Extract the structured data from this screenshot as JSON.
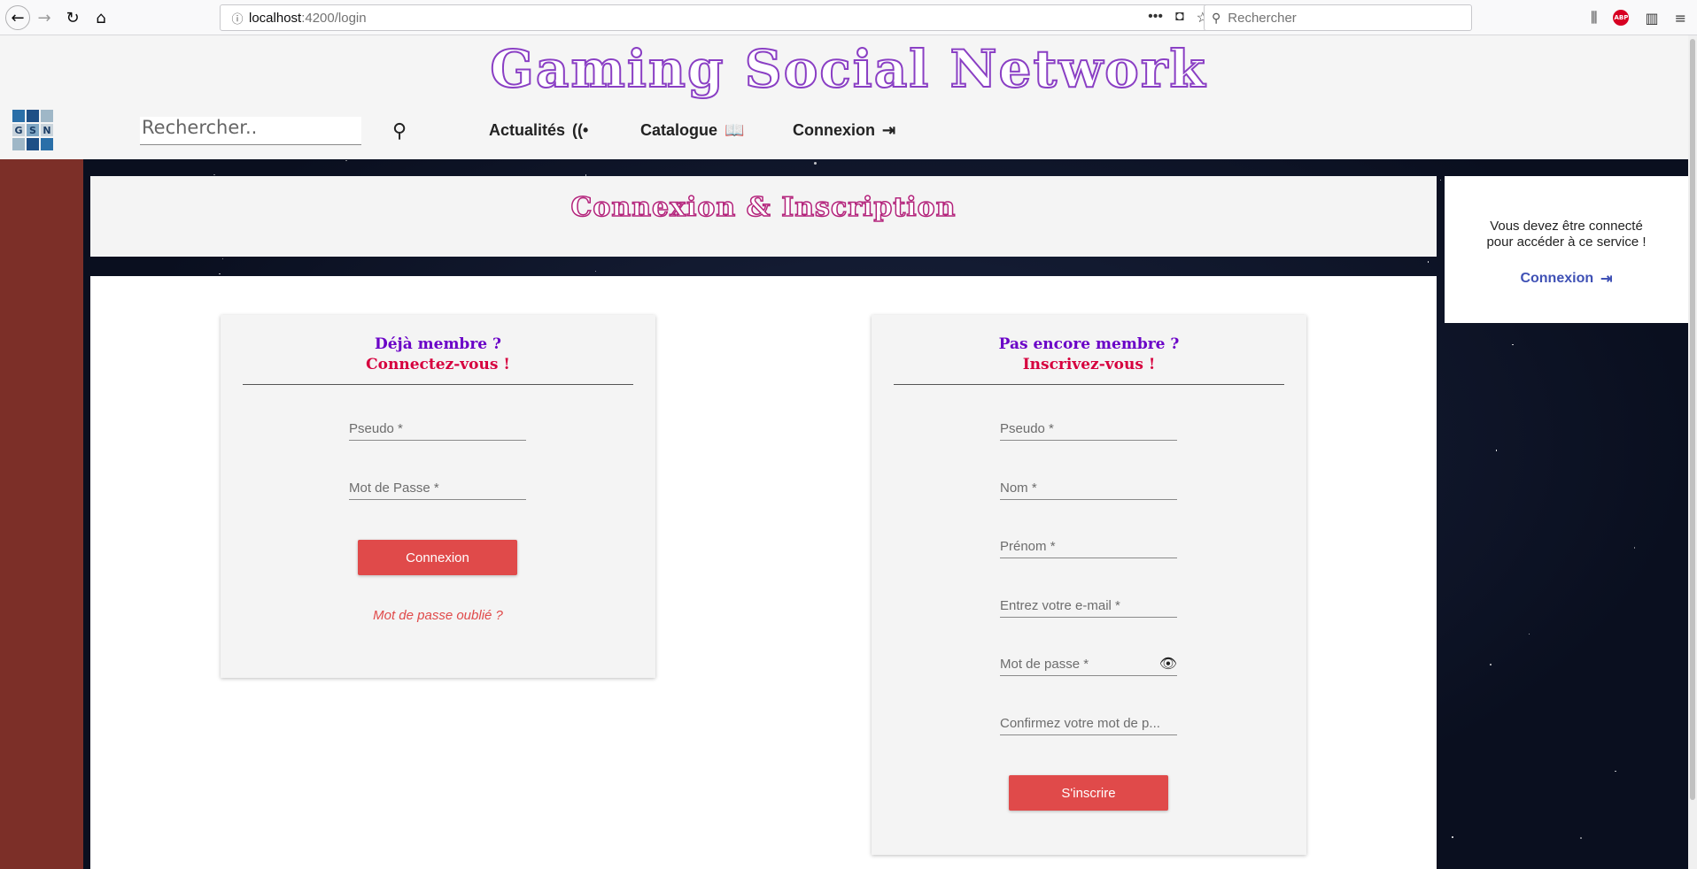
{
  "browser": {
    "url_host": "localhost",
    "url_path": ":4200/login",
    "search_placeholder": "Rechercher"
  },
  "header": {
    "site_title": "Gaming Social Network",
    "logo_letters": [
      "G",
      "S",
      "N"
    ],
    "search_placeholder": "Rechercher..",
    "nav": [
      {
        "label": "Actualités",
        "icon": "rss-icon"
      },
      {
        "label": "Catalogue",
        "icon": "book-reader-icon"
      },
      {
        "label": "Connexion",
        "icon": "sign-in-icon"
      }
    ]
  },
  "page": {
    "title": "Connexion & Inscription"
  },
  "sidebar": {
    "message": "Vous devez être connecté\npour accéder à ce service !",
    "link_label": "Connexion"
  },
  "login": {
    "heading_line1": "Déjà membre ?",
    "heading_line2": "Connectez-vous !",
    "fields": [
      "Pseudo *",
      "Mot de Passe *"
    ],
    "button": "Connexion",
    "forgot": "Mot de passe oublié ?"
  },
  "signup": {
    "heading_line1": "Pas encore membre ?",
    "heading_line2": "Inscrivez-vous !",
    "fields": [
      "Pseudo *",
      "Nom *",
      "Prénom *",
      "Entrez votre e-mail *",
      "Mot de passe *",
      "Confirmez votre mot de p..."
    ],
    "button": "S'inscrire"
  },
  "colors": {
    "accent_button": "#e04a4a",
    "link_blue": "#3f51b5",
    "heading_purple": "#6a00c7",
    "heading_red": "#d6003e"
  }
}
